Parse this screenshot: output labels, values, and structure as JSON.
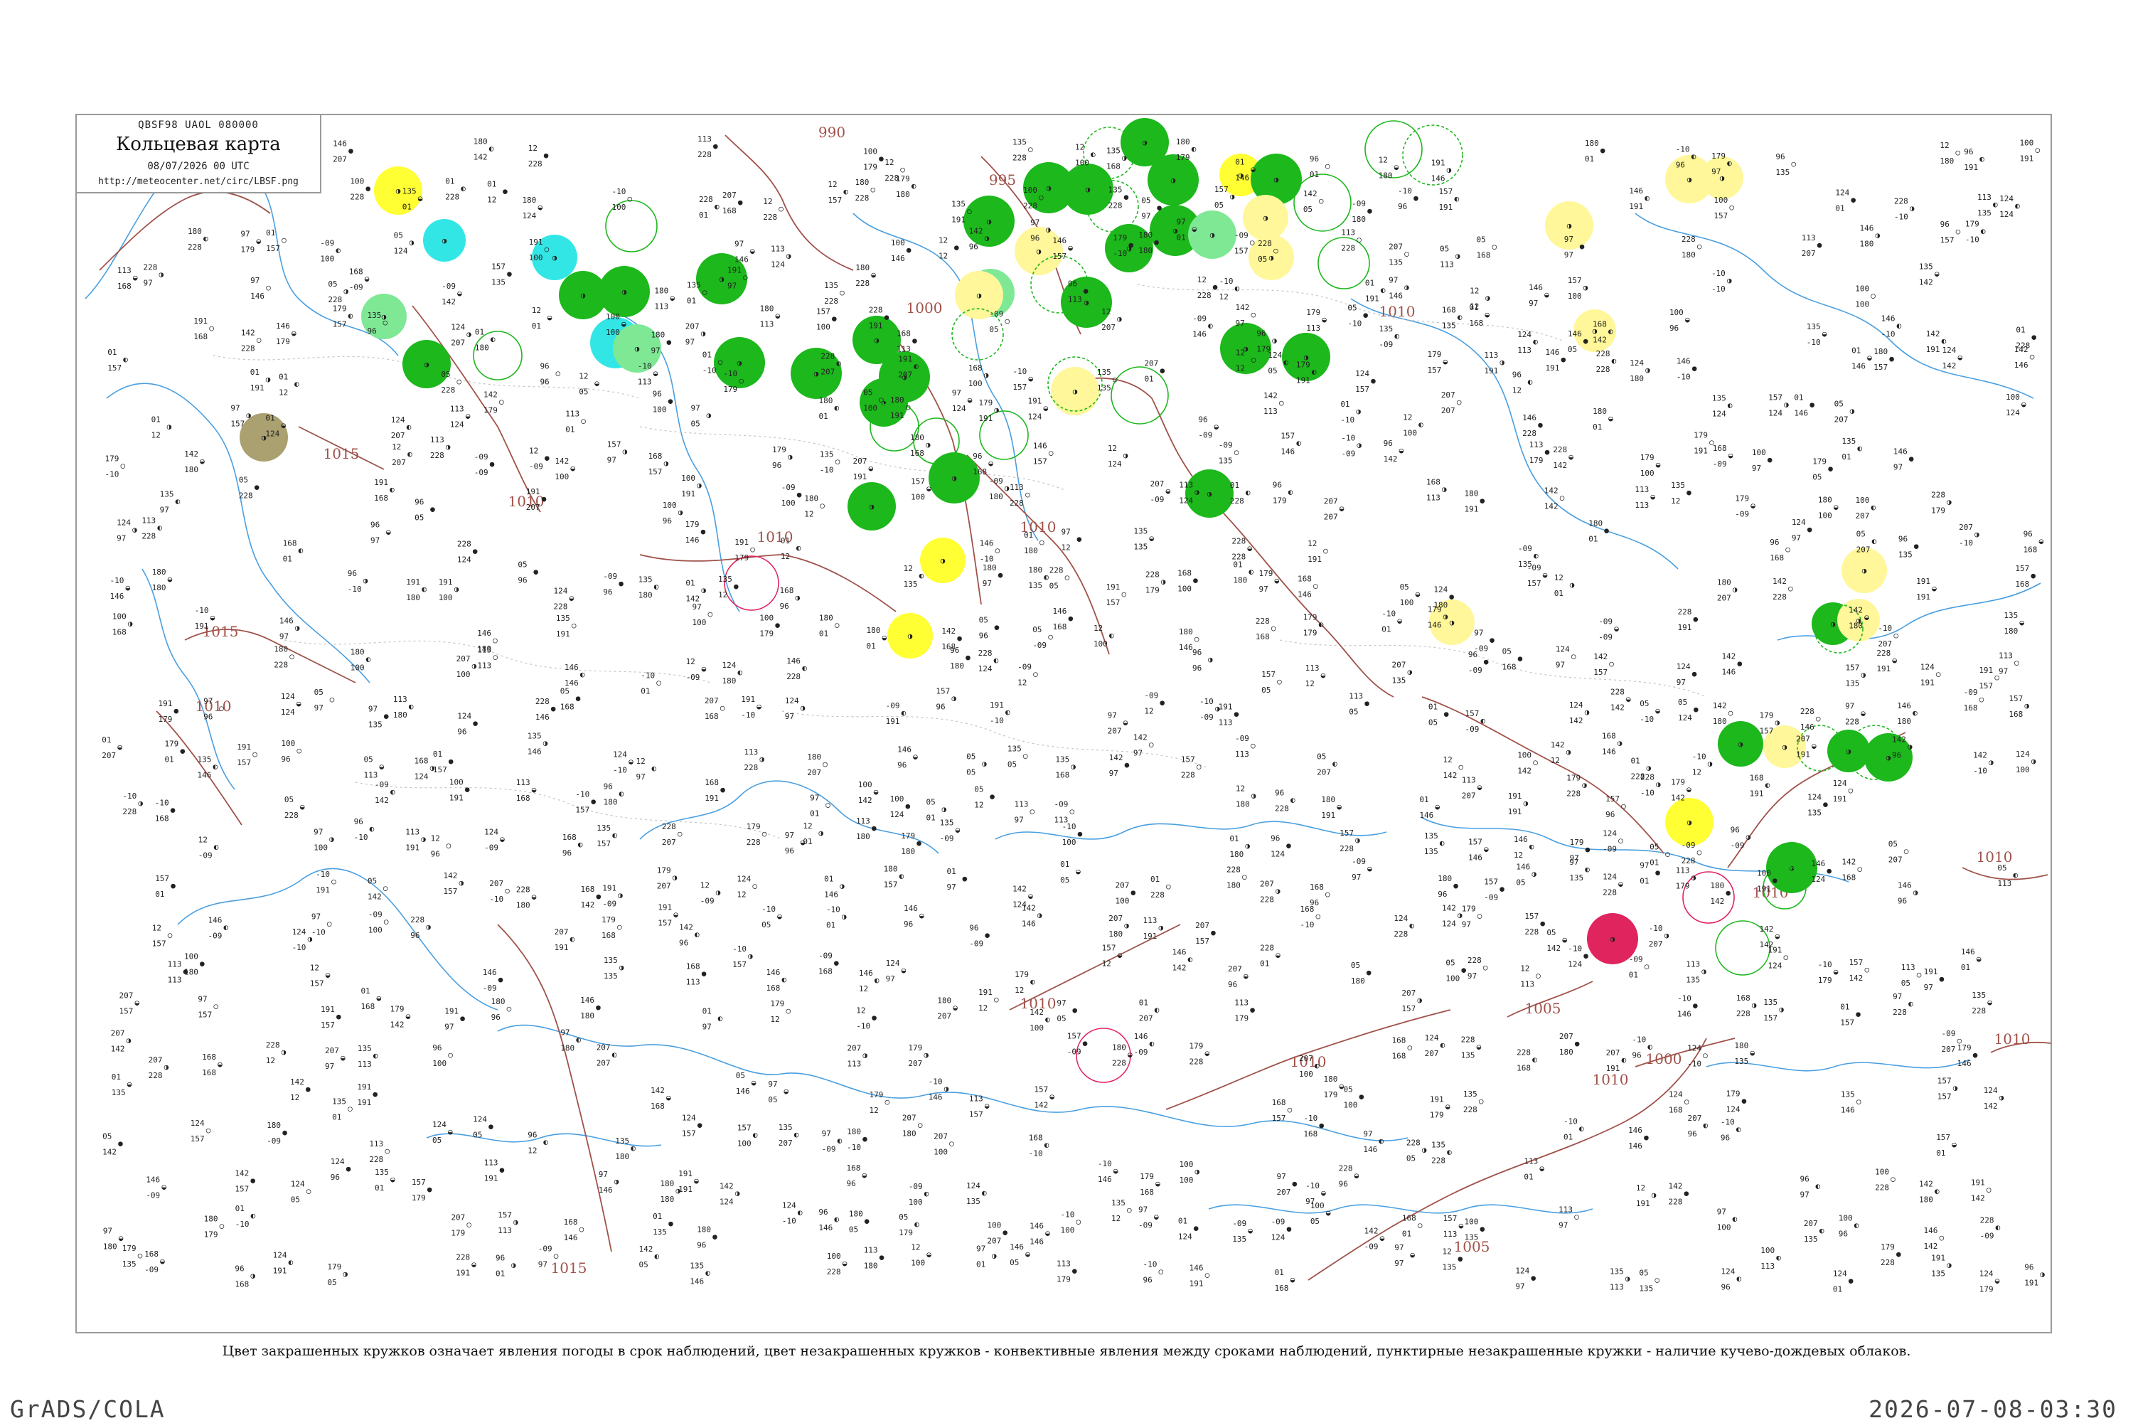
{
  "header": {
    "code": "QBSF98  UAOL  080000",
    "title": "Кольцевая карта",
    "time": "08/07/2026 00 UTC",
    "url": "http://meteocenter.net/circ/LBSF.png"
  },
  "caption": "Цвет закрашенных кружков означает явления погоды в срок наблюдений, цвет незакрашенных кружков - конвективные явления между сроками наблюдений, пунктирные незакрашенные кружки - наличие кучево-дождевых облаков.",
  "footer": {
    "left": "GrADS/COLA",
    "right": "2026-07-08-03:30"
  },
  "colors": {
    "isobar": "#a0524a",
    "coast": "#4a9fe0",
    "border": "#c5c5c5",
    "rain": "#1cb81c",
    "showers": "#7ee895",
    "thunder": "#ffff33",
    "light": "#fff799",
    "fog": "#aaa070",
    "snow": "#33e6e6",
    "red": "#e0245e"
  },
  "isobars": [
    {
      "label": "990"
    },
    {
      "label": "995"
    },
    {
      "label": "1000"
    },
    {
      "label": "1005"
    },
    {
      "label": "1010"
    },
    {
      "label": "1015"
    }
  ]
}
